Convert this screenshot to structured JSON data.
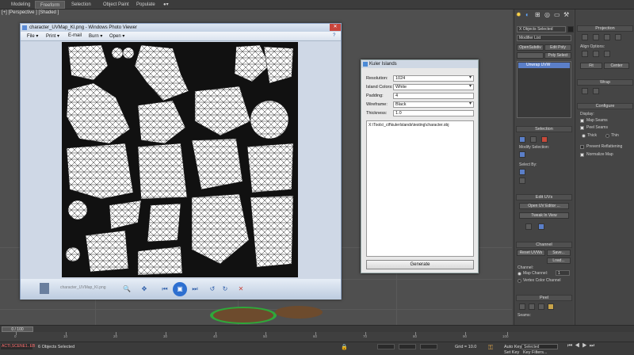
{
  "ribbon": {
    "tabs": [
      "Modeling",
      "Freeform",
      "Selection",
      "Object Paint",
      "Populate"
    ],
    "active": "Freeform"
  },
  "viewport": {
    "label": "[+] [Perspective ] [Shaded ]"
  },
  "photo_viewer": {
    "title": "character_UVMap_KI.png - Windows Photo Viewer",
    "menu": [
      "File ▾",
      "Print ▾",
      "E-mail",
      "Burn ▾",
      "Open ▾"
    ],
    "taskbar_thumb_label": "character_UVMap_KI.png"
  },
  "kuler": {
    "title": "Kuler Islands",
    "fields": [
      {
        "label": "Resolution:",
        "value": "1024"
      },
      {
        "label": "Island Colors:",
        "value": "White"
      },
      {
        "label": "Padding:",
        "value": "4"
      },
      {
        "label": "Wireframe:",
        "value": "Black"
      },
      {
        "label": "Thickness:",
        "value": "1.0"
      }
    ],
    "path": "X:\\Tools\\_ctf\\kulerIslands\\testing\\character.obj",
    "generate": "Generate"
  },
  "command_panel": {
    "object_name": "X Objects Selected",
    "modifier_list": "Modifier List",
    "buttons_row1": [
      "OpenSubdiv",
      "Edit Poly"
    ],
    "buttons_row2": [
      "Poly Select"
    ],
    "stack_item": "Unwrap UVW",
    "selection": "Selection",
    "modify_selection": "Modify Selection:",
    "select_by": "Select By:",
    "edit_uvs": "Edit UVs",
    "open_uv_editor": "Open UV Editor ...",
    "tweak_in_view": "Tweak In View",
    "channel": "Channel",
    "reset_uvws": "Reset UVWs",
    "save": "Save...",
    "load": "Load...",
    "channel_label": "Channel:",
    "map_channel": "Map Channel:",
    "map_channel_value": "1",
    "vertex_color_channel": "Vertex Color Channel",
    "peel": "Peel",
    "seams": "Seams:"
  },
  "right_panel": {
    "projection": "Projection",
    "align_options": "Align Options:",
    "fit": "Fit",
    "center": "Center",
    "wrap": "Wrap",
    "configure": "Configure",
    "display": "Display:",
    "map_seams": "Map Seams",
    "peel_seams": "Peel Seams",
    "thick": "Thick",
    "thin": "Thin",
    "prevent_reflattening": "Prevent Reflattening",
    "normalize_map": "Normalize Map"
  },
  "timeline": {
    "frame": "0 / 100",
    "ticks": [
      "0",
      "10",
      "20",
      "30",
      "40",
      "50",
      "60",
      "70",
      "80",
      "90",
      "100"
    ]
  },
  "status": {
    "script": "ACTI,SCENE1..EB",
    "objects_selected": "6 Objects Selected",
    "grid": "Grid = 10.0",
    "autokey": "Auto Key",
    "selected": "Selected",
    "setkey": "Set Key",
    "keyfilters": "Key Filters..."
  },
  "colors": {
    "kuler_dialog_bg": "#e8e8e8",
    "uv_background": "#111111",
    "uv_islands": "#ffffff",
    "max_ui": "#444444"
  }
}
